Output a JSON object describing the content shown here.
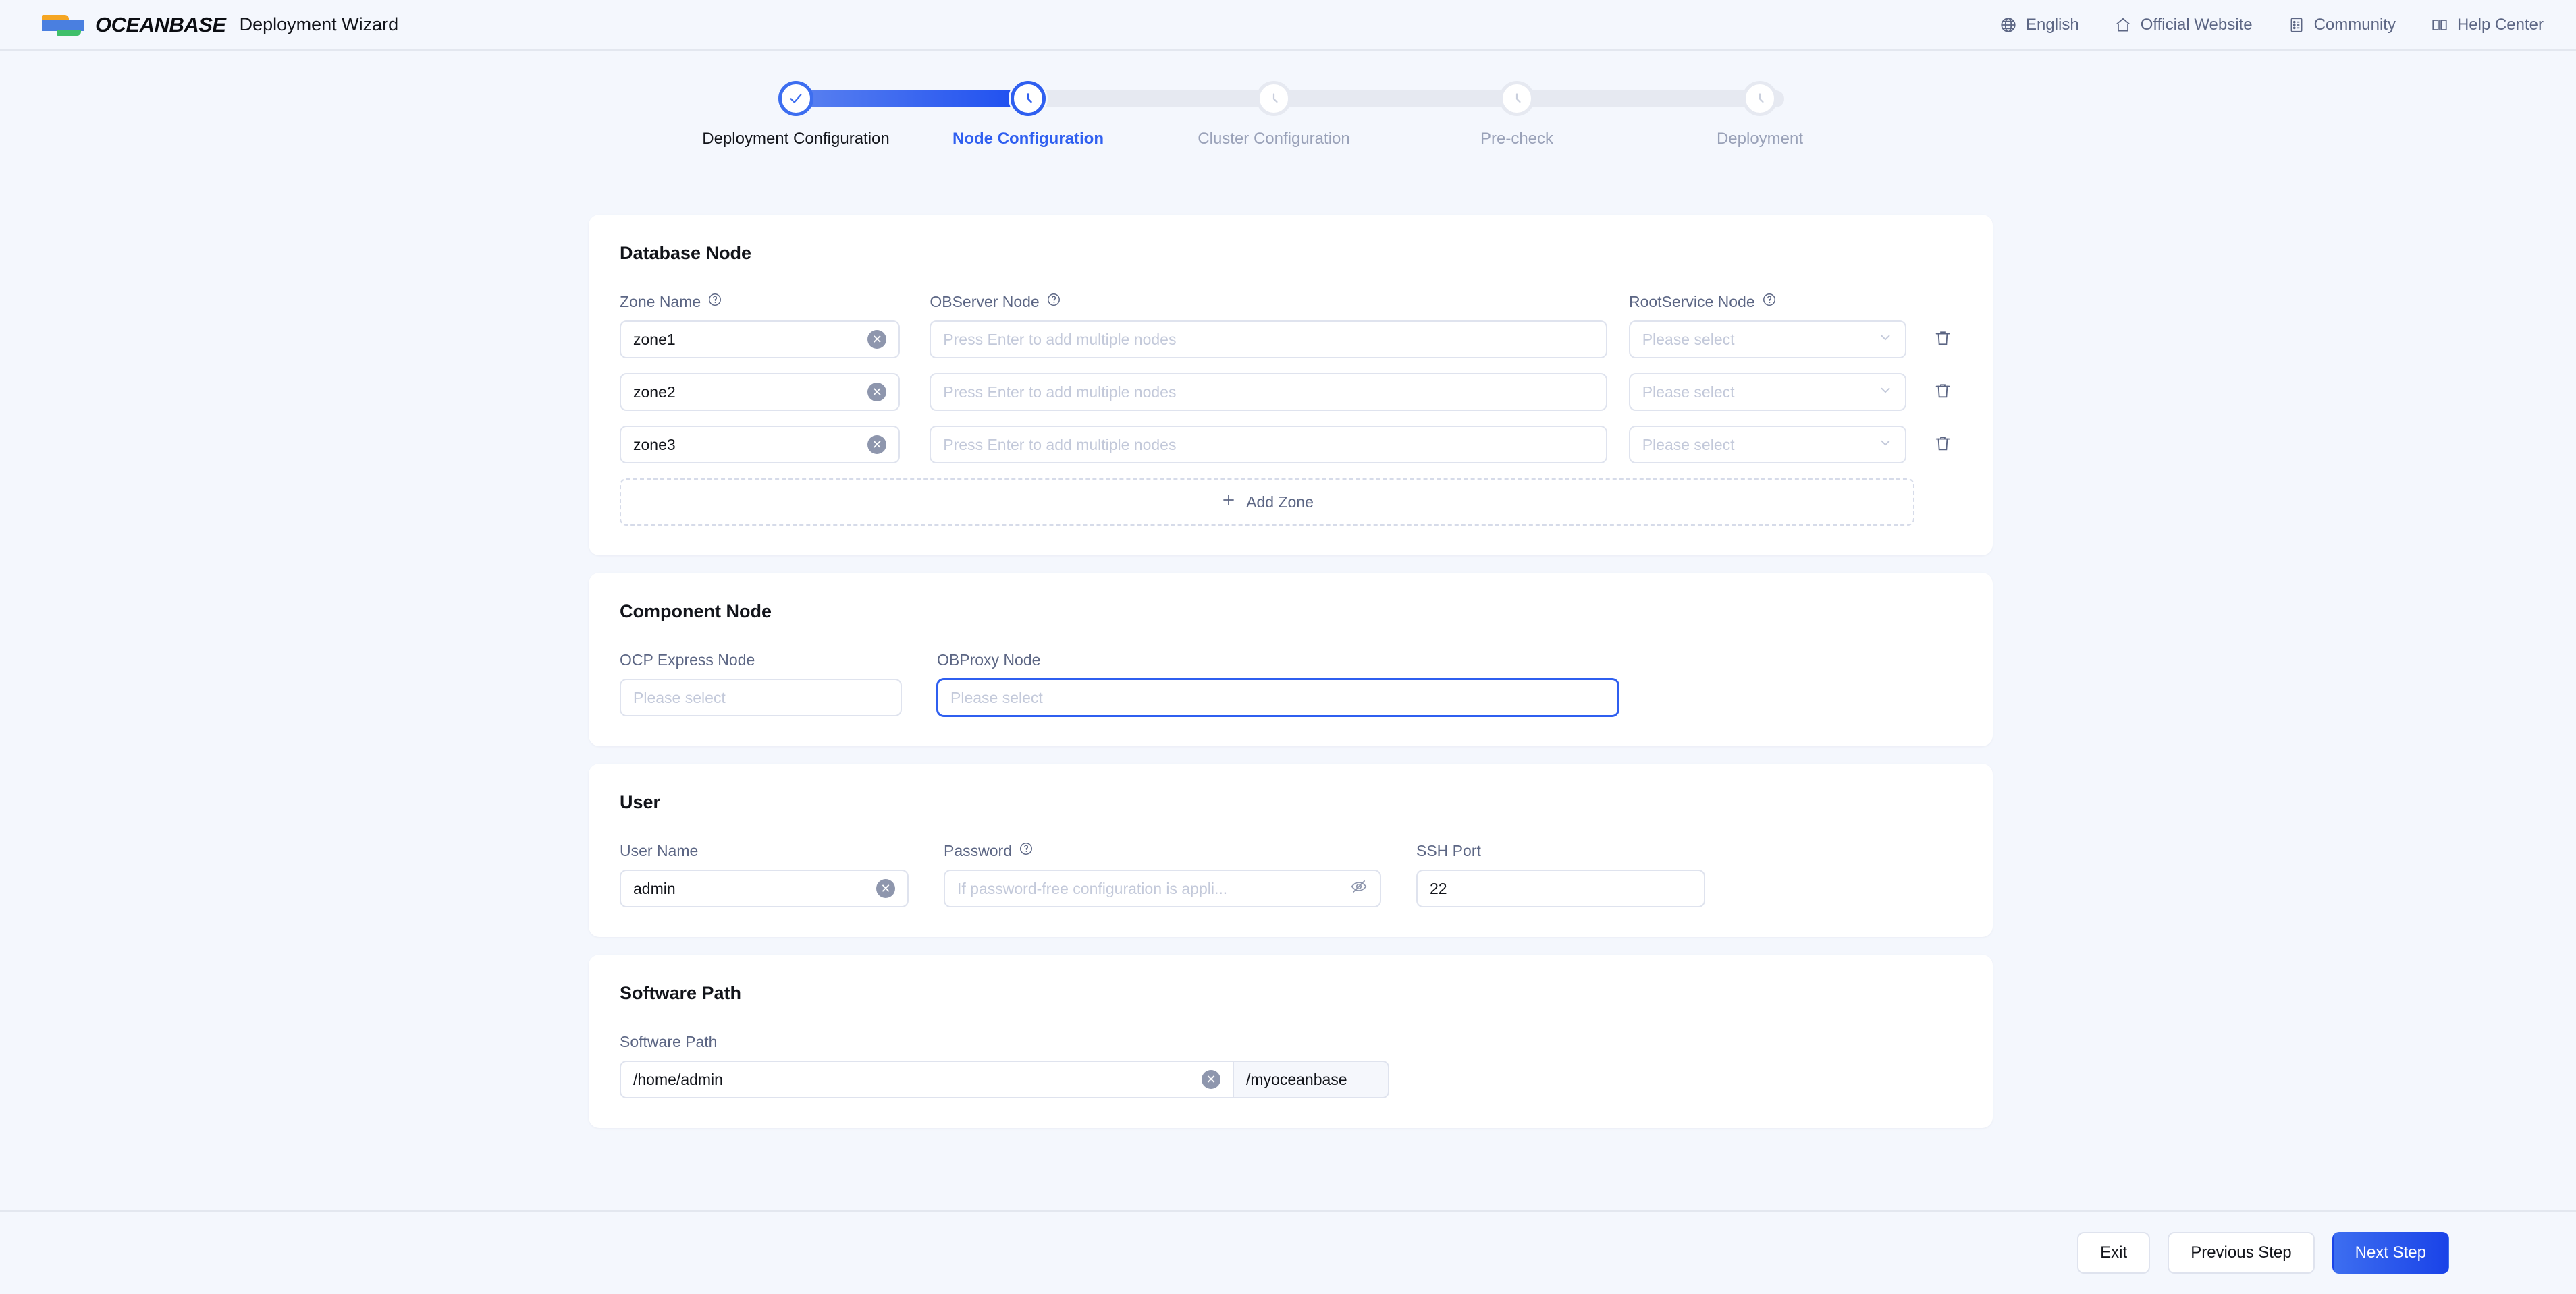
{
  "header": {
    "brand": "OCEANBASE",
    "app_title": "Deployment Wizard",
    "nav": [
      {
        "label": "English",
        "icon": "globe-icon"
      },
      {
        "label": "Official Website",
        "icon": "home-icon"
      },
      {
        "label": "Community",
        "icon": "list-doc-icon"
      },
      {
        "label": "Help Center",
        "icon": "book-icon"
      }
    ]
  },
  "stepper": {
    "active_index": 1,
    "steps": [
      {
        "label": "Deployment Configuration",
        "state": "done"
      },
      {
        "label": "Node Configuration",
        "state": "current"
      },
      {
        "label": "Cluster Configuration",
        "state": "pending"
      },
      {
        "label": "Pre-check",
        "state": "pending"
      },
      {
        "label": "Deployment",
        "state": "pending"
      }
    ]
  },
  "database_node": {
    "title": "Database Node",
    "columns": {
      "zone_name": "Zone Name",
      "observer_node": "OBServer Node",
      "rootservice_node": "RootService Node"
    },
    "rows": [
      {
        "zone": "zone1",
        "observer_placeholder": "Press Enter to add multiple nodes",
        "rootservice_placeholder": "Please select"
      },
      {
        "zone": "zone2",
        "observer_placeholder": "Press Enter to add multiple nodes",
        "rootservice_placeholder": "Please select"
      },
      {
        "zone": "zone3",
        "observer_placeholder": "Press Enter to add multiple nodes",
        "rootservice_placeholder": "Please select"
      }
    ],
    "add_zone_label": "Add Zone"
  },
  "component_node": {
    "title": "Component Node",
    "ocp_express": {
      "label": "OCP Express Node",
      "placeholder": "Please select",
      "value": ""
    },
    "obproxy": {
      "label": "OBProxy Node",
      "placeholder": "Please select",
      "value": "",
      "focused": true
    }
  },
  "user": {
    "title": "User",
    "user_name": {
      "label": "User Name",
      "value": "admin"
    },
    "password": {
      "label": "Password",
      "placeholder": "If password-free configuration is appli...",
      "value": ""
    },
    "ssh_port": {
      "label": "SSH Port",
      "value": "22"
    }
  },
  "software_path": {
    "title": "Software Path",
    "label": "Software Path",
    "value": "/home/admin",
    "suffix": "/myoceanbase"
  },
  "footer": {
    "exit": "Exit",
    "previous": "Previous Step",
    "next": "Next Step"
  },
  "colors": {
    "page_bg": "#f4f7fd",
    "accent": "#2f5ff0",
    "text": "#12141a",
    "muted": "#5c6684",
    "placeholder": "#c3c9da",
    "border": "#dfe3ee"
  }
}
